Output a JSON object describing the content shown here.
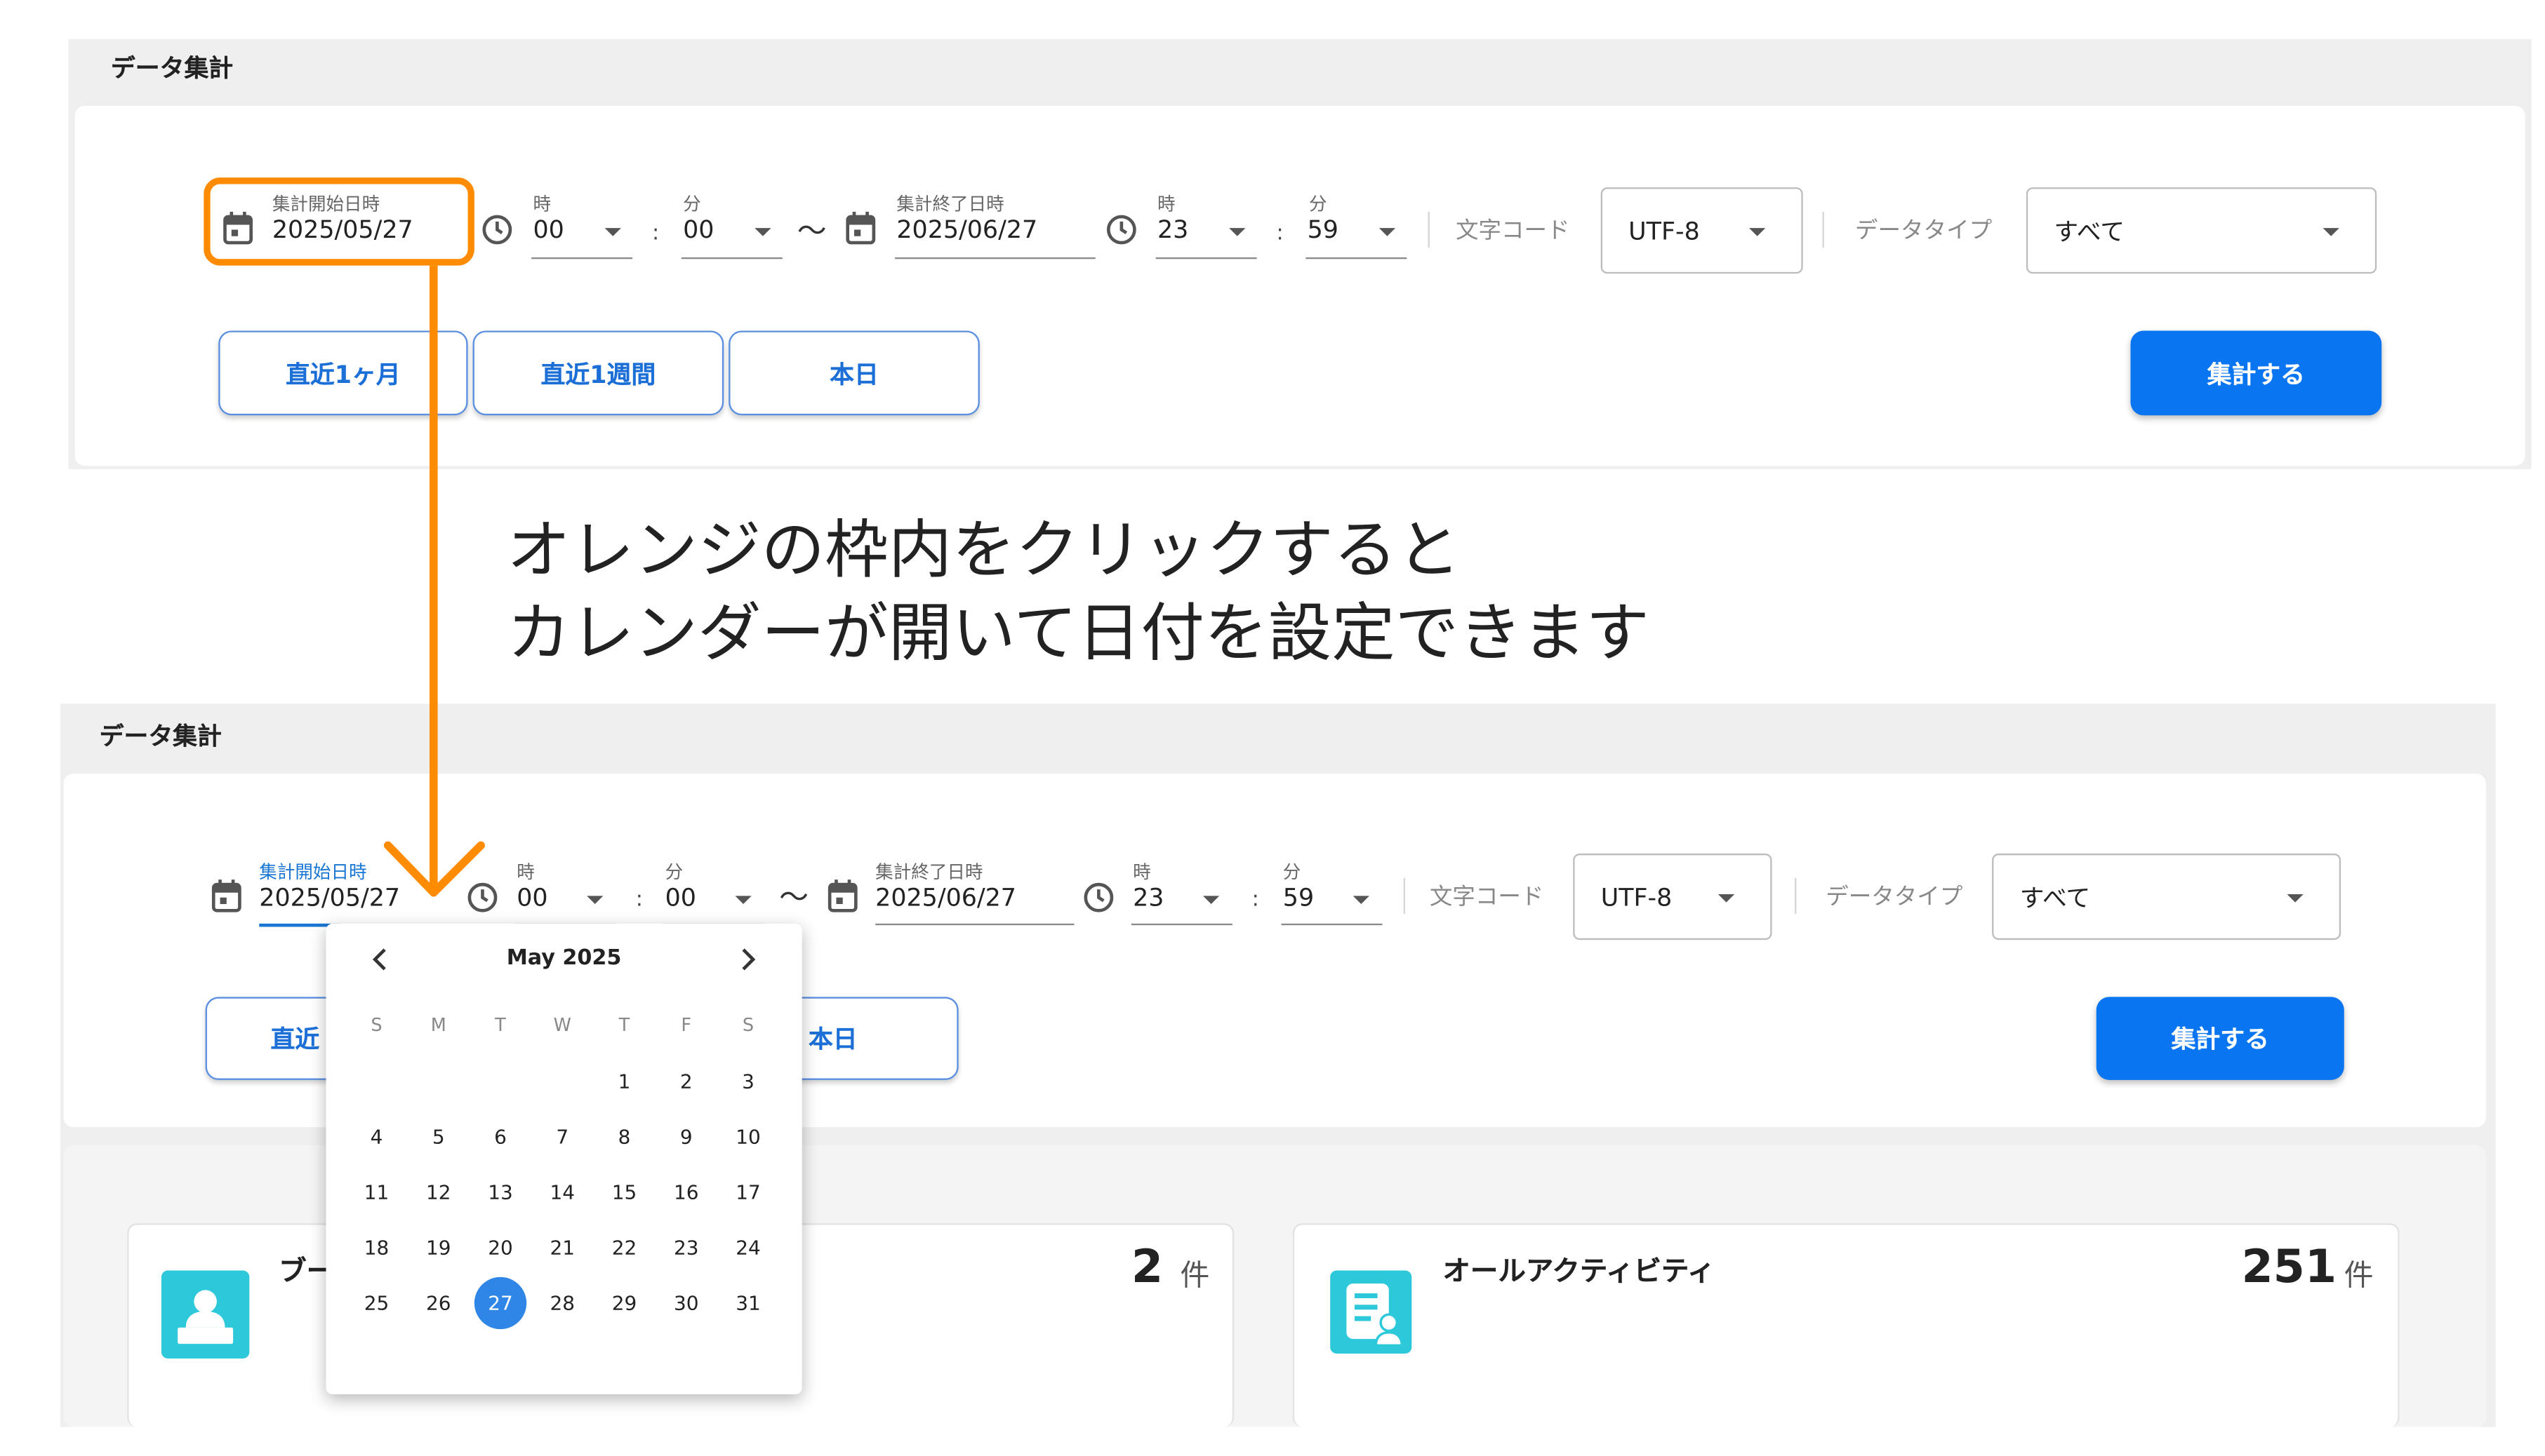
{
  "top_panel": {
    "title": "データ集計",
    "start": {
      "label": "集計開始日時",
      "date": "2025/05/27",
      "hour_label": "時",
      "hour": "00",
      "minute_label": "分",
      "minute": "00"
    },
    "end": {
      "label": "集計終了日時",
      "date": "2025/06/27",
      "hour_label": "時",
      "hour": "23",
      "minute_label": "分",
      "minute": "59"
    },
    "tilde": "〜",
    "colon": ":",
    "charset_label": "文字コード",
    "charset_value": "UTF-8",
    "datatype_label": "データタイプ",
    "datatype_value": "すべて",
    "quick_buttons": [
      "直近1ヶ月",
      "直近1週間",
      "本日"
    ],
    "submit_label": "集計する"
  },
  "annotation": {
    "line1": "オレンジの枠内をクリックすると",
    "line2": "カレンダーが開いて日付を設定できます",
    "highlight_color": "#ff8c00"
  },
  "bottom_panel": {
    "title": "データ集計",
    "start": {
      "label": "集計開始日時",
      "date": "2025/05/27",
      "hour_label": "時",
      "hour": "00",
      "minute_label": "分",
      "minute": "00"
    },
    "end": {
      "label": "集計終了日時",
      "date": "2025/06/27",
      "hour_label": "時",
      "hour": "23",
      "minute_label": "分",
      "minute": "59"
    },
    "tilde": "〜",
    "colon": ":",
    "charset_label": "文字コード",
    "charset_value": "UTF-8",
    "datatype_label": "データタイプ",
    "datatype_value": "すべて",
    "quick_buttons": [
      "直近",
      "本日"
    ],
    "submit_label": "集計する"
  },
  "calendar": {
    "month_label": "May 2025",
    "weekdays": [
      "S",
      "M",
      "T",
      "W",
      "T",
      "F",
      "S"
    ],
    "first_weekday_index": 4,
    "days_in_month": 31,
    "selected_day": 27,
    "selected_color": "#2f86e6"
  },
  "stats": [
    {
      "title": "ブー",
      "count": "2",
      "unit": "件",
      "icon": "user-card-icon"
    },
    {
      "title": "オールアクティビティ",
      "count": "251",
      "unit": "件",
      "icon": "checklist-user-icon"
    }
  ],
  "colors": {
    "primary": "#0a75f0",
    "outline": "#5b8fe0",
    "accent_orange": "#ff8c00",
    "icon_teal": "#2ec8db"
  }
}
